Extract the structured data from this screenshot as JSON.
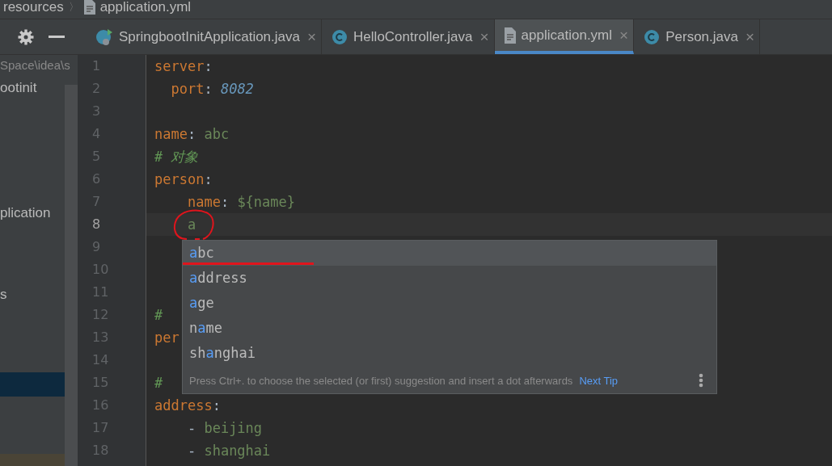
{
  "breadcrumb": {
    "folder": "resources",
    "separator": "〉",
    "file": "application.yml"
  },
  "sidebar": {
    "path": "Space\\idea\\s",
    "items": [
      {
        "text": "ootinit",
        "selected": false
      },
      {
        "text": "plication",
        "selected": false
      },
      {
        "text": "s",
        "selected": false
      },
      {
        "selected": true
      }
    ]
  },
  "tabs": [
    {
      "label": "SpringbootInitApplication.java",
      "kind": "runnable-class",
      "selected": false,
      "close": "×"
    },
    {
      "label": "HelloController.java",
      "kind": "class",
      "selected": false,
      "close": "×"
    },
    {
      "label": "application.yml",
      "kind": "file",
      "selected": true,
      "close": "×"
    },
    {
      "label": "Person.java",
      "kind": "class",
      "selected": false,
      "close": "×"
    }
  ],
  "editor": {
    "lines": [
      {
        "number": "1",
        "current": false,
        "tokens": [
          {
            "kind": "key",
            "text": "server"
          },
          {
            "kind": "punct",
            "text": ":"
          }
        ]
      },
      {
        "number": "2",
        "current": false,
        "tokens": [
          {
            "kind": "key",
            "text": "  port"
          },
          {
            "kind": "punct",
            "text": ": "
          },
          {
            "kind": "number",
            "text": "8082"
          }
        ]
      },
      {
        "number": "3",
        "current": false
      },
      {
        "number": "4",
        "current": false,
        "tokens": [
          {
            "kind": "key",
            "text": "name"
          },
          {
            "kind": "punct",
            "text": ": "
          },
          {
            "kind": "value",
            "text": "abc"
          }
        ]
      },
      {
        "number": "5",
        "current": false,
        "tokens": [
          {
            "kind": "comment",
            "text": "# 对象"
          }
        ]
      },
      {
        "number": "6",
        "current": false,
        "tokens": [
          {
            "kind": "key",
            "text": "person"
          },
          {
            "kind": "punct",
            "text": ":"
          }
        ]
      },
      {
        "number": "7",
        "current": false,
        "tokens": [
          {
            "kind": "key",
            "text": "    name"
          },
          {
            "kind": "punct",
            "text": ": "
          },
          {
            "kind": "value",
            "text": "${name}"
          }
        ]
      },
      {
        "number": "8",
        "current": true,
        "tokens": [
          {
            "kind": "value",
            "text": "    a"
          }
        ]
      },
      {
        "number": "9",
        "current": false
      },
      {
        "number": "10",
        "current": false
      },
      {
        "number": "11",
        "current": false
      },
      {
        "number": "12",
        "current": false,
        "tokens": [
          {
            "kind": "comment",
            "text": "#"
          }
        ]
      },
      {
        "number": "13",
        "current": false,
        "tokens": [
          {
            "kind": "key",
            "text": "per"
          }
        ]
      },
      {
        "number": "14",
        "current": false
      },
      {
        "number": "15",
        "current": false,
        "tokens": [
          {
            "kind": "comment",
            "text": "#"
          }
        ]
      },
      {
        "number": "16",
        "current": false,
        "tokens": [
          {
            "kind": "key",
            "text": "address"
          },
          {
            "kind": "punct",
            "text": ":"
          }
        ]
      },
      {
        "number": "17",
        "current": false,
        "tokens": [
          {
            "kind": "punct",
            "text": "    - "
          },
          {
            "kind": "value",
            "text": "beijing"
          }
        ]
      },
      {
        "number": "18",
        "current": false,
        "tokens": [
          {
            "kind": "punct",
            "text": "    - "
          },
          {
            "kind": "value",
            "text": "shanghai"
          }
        ]
      }
    ]
  },
  "completion": {
    "items": [
      {
        "match": "a",
        "after": "bc",
        "selected": true
      },
      {
        "match": "a",
        "after": "ddress",
        "selected": false
      },
      {
        "match": "a",
        "after": "ge",
        "selected": false
      },
      {
        "before": "n",
        "match": "a",
        "after": "me",
        "selected": false
      },
      {
        "before": "sh",
        "match": "a",
        "after": "nghai",
        "selected": false
      }
    ],
    "hint": "Press Ctrl+. to choose the selected (or first) suggestion and insert a dot afterwards",
    "link": "Next Tip"
  }
}
